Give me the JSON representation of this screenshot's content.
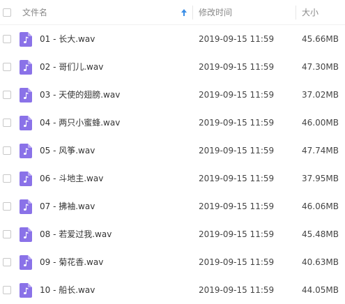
{
  "header": {
    "name_label": "文件名",
    "modified_label": "修改时间",
    "size_label": "大小"
  },
  "colors": {
    "file_icon": "#8a72e8",
    "sort_arrow": "#3a8ee6"
  },
  "files": [
    {
      "name": "01 - 长大.wav",
      "modified": "2019-09-15 11:59",
      "size": "45.66MB"
    },
    {
      "name": "02 - 哥们儿.wav",
      "modified": "2019-09-15 11:59",
      "size": "47.30MB"
    },
    {
      "name": "03 - 天使的翅膀.wav",
      "modified": "2019-09-15 11:59",
      "size": "37.02MB"
    },
    {
      "name": "04 - 两只小蜜蜂.wav",
      "modified": "2019-09-15 11:59",
      "size": "46.00MB"
    },
    {
      "name": "05 - 风筝.wav",
      "modified": "2019-09-15 11:59",
      "size": "47.74MB"
    },
    {
      "name": "06 - 斗地主.wav",
      "modified": "2019-09-15 11:59",
      "size": "37.95MB"
    },
    {
      "name": "07 - 拂袖.wav",
      "modified": "2019-09-15 11:59",
      "size": "46.06MB"
    },
    {
      "name": "08 - 若爱过我.wav",
      "modified": "2019-09-15 11:59",
      "size": "45.48MB"
    },
    {
      "name": "09 - 菊花香.wav",
      "modified": "2019-09-15 11:59",
      "size": "40.63MB"
    },
    {
      "name": "10 - 船长.wav",
      "modified": "2019-09-15 11:59",
      "size": "44.05MB"
    }
  ]
}
